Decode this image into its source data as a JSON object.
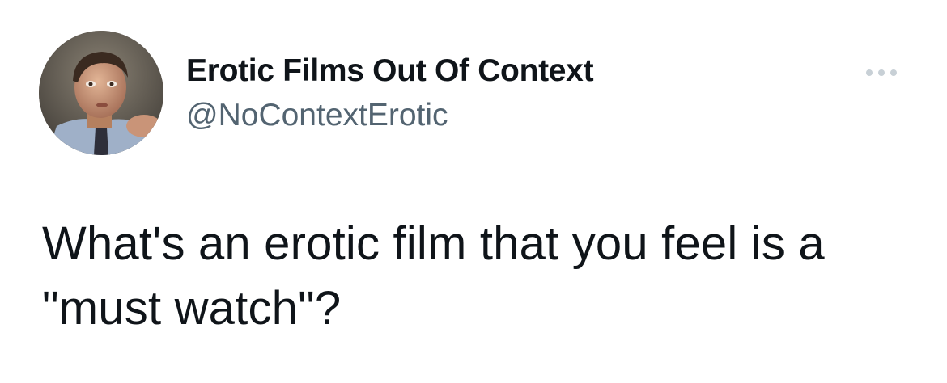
{
  "tweet": {
    "display_name": "Erotic Films Out Of Context",
    "handle": "@NoContextErotic",
    "text": "What's an erotic film that you feel is a \"must watch\"?",
    "more_icon": "more-horizontal-icon",
    "avatar_description_icon": "avatar-photo"
  },
  "colors": {
    "text_primary": "#0f1419",
    "text_secondary": "#536471",
    "more_dots": "#c8d0d6",
    "background": "#ffffff"
  }
}
